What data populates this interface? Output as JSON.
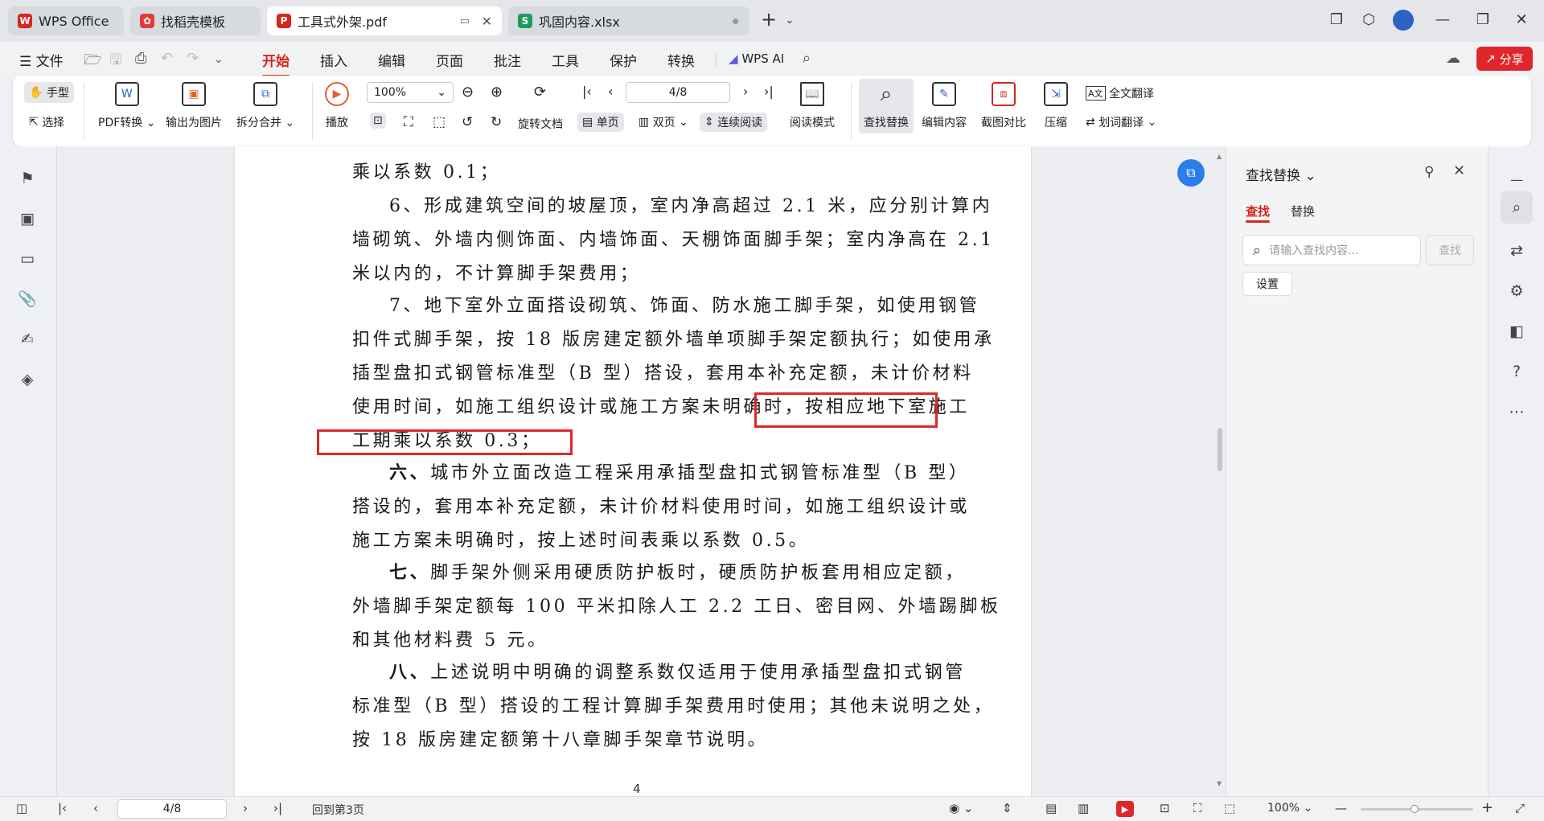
{
  "tabs": [
    {
      "label": "WPS Office",
      "icon": "wps-logo"
    },
    {
      "label": "找稻壳模板",
      "icon": "docer-icon"
    },
    {
      "label": "工具式外架.pdf",
      "icon": "pdf-icon"
    },
    {
      "label": "巩固内容.xlsx",
      "icon": "xlsx-icon"
    }
  ],
  "menu": {
    "file": "文件",
    "items": [
      "开始",
      "插入",
      "编辑",
      "页面",
      "批注",
      "工具",
      "保护",
      "转换"
    ],
    "active": "开始",
    "wps_ai": "WPS AI",
    "share": "分享"
  },
  "ribbon": {
    "hand": "手型",
    "select": "选择",
    "pdf_convert": "PDF转换",
    "export_image": "输出为图片",
    "split_merge": "拆分合并",
    "play": "播放",
    "zoom": "100%",
    "page_input": "4/8",
    "rotate": "旋转文档",
    "single": "单页",
    "double": "双页",
    "continuous": "连续阅读",
    "read_mode": "阅读模式",
    "find_replace": "查找替换",
    "edit_content": "编辑内容",
    "screenshot_compare": "截图对比",
    "compress": "压缩",
    "full_translate": "全文翻译",
    "word_translate": "划词翻译"
  },
  "document": {
    "lines": [
      "乘以系数 0.1；",
      "6、形成建筑空间的坡屋顶，室内净高超过 2.1 米，应分别计算内",
      "墙砌筑、外墙内侧饰面、内墙饰面、天棚饰面脚手架；室内净高在 2.1",
      "米以内的，不计算脚手架费用；",
      "7、地下室外立面搭设砌筑、饰面、防水施工脚手架，如使用钢管",
      "扣件式脚手架，按 18 版房建定额外墙单项脚手架定额执行；如使用承",
      "插型盘扣式钢管标准型（B 型）搭设，套用本补充定额，未计价材料",
      "使用时间，如施工组织设计或施工方案未明确时，按相应地下室施工",
      "工期乘以系数 0.3；",
      "六、城市外立面改造工程采用承插型盘扣式钢管标准型（B 型）",
      "搭设的，套用本补充定额，未计价材料使用时间，如施工组织设计或",
      "施工方案未明确时，按上述时间表乘以系数 0.5。",
      "七、脚手架外侧采用硬质防护板时，硬质防护板套用相应定额，",
      "外墙脚手架定额每 100 平米扣除人工 2.2 工日、密目网、外墙踢脚板",
      "和其他材料费 5 元。",
      "八、上述说明中明确的调整系数仅适用于使用承插型盘扣式钢管",
      "标准型（B 型）搭设的工程计算脚手架费用时使用；其他未说明之处，",
      "按 18 版房建定额第十八章脚手架章节说明。"
    ],
    "bold_prefix": [
      "六、",
      "七、",
      "八、"
    ],
    "bold_rest": [
      "城市外立面改造工程采用承插型盘扣式钢管标准型（B 型）",
      "脚手架外侧采用硬质防护板时，硬质防护板套用相应定额，",
      "上述说明中明确的调整系数仅适用于使用承插型盘扣式钢管"
    ],
    "page_number": "4"
  },
  "find_panel": {
    "title": "查找替换",
    "tab_find": "查找",
    "tab_replace": "替换",
    "placeholder": "请输入查找内容...",
    "find_button": "查找",
    "settings_button": "设置"
  },
  "status": {
    "page_input": "4/8",
    "back_to_page": "回到第3页",
    "zoom": "100%"
  },
  "colors": {
    "accent": "#d7261b",
    "annotation": "#e0262b",
    "pdf": "#d7261b",
    "xlsx": "#1e9a5a"
  }
}
